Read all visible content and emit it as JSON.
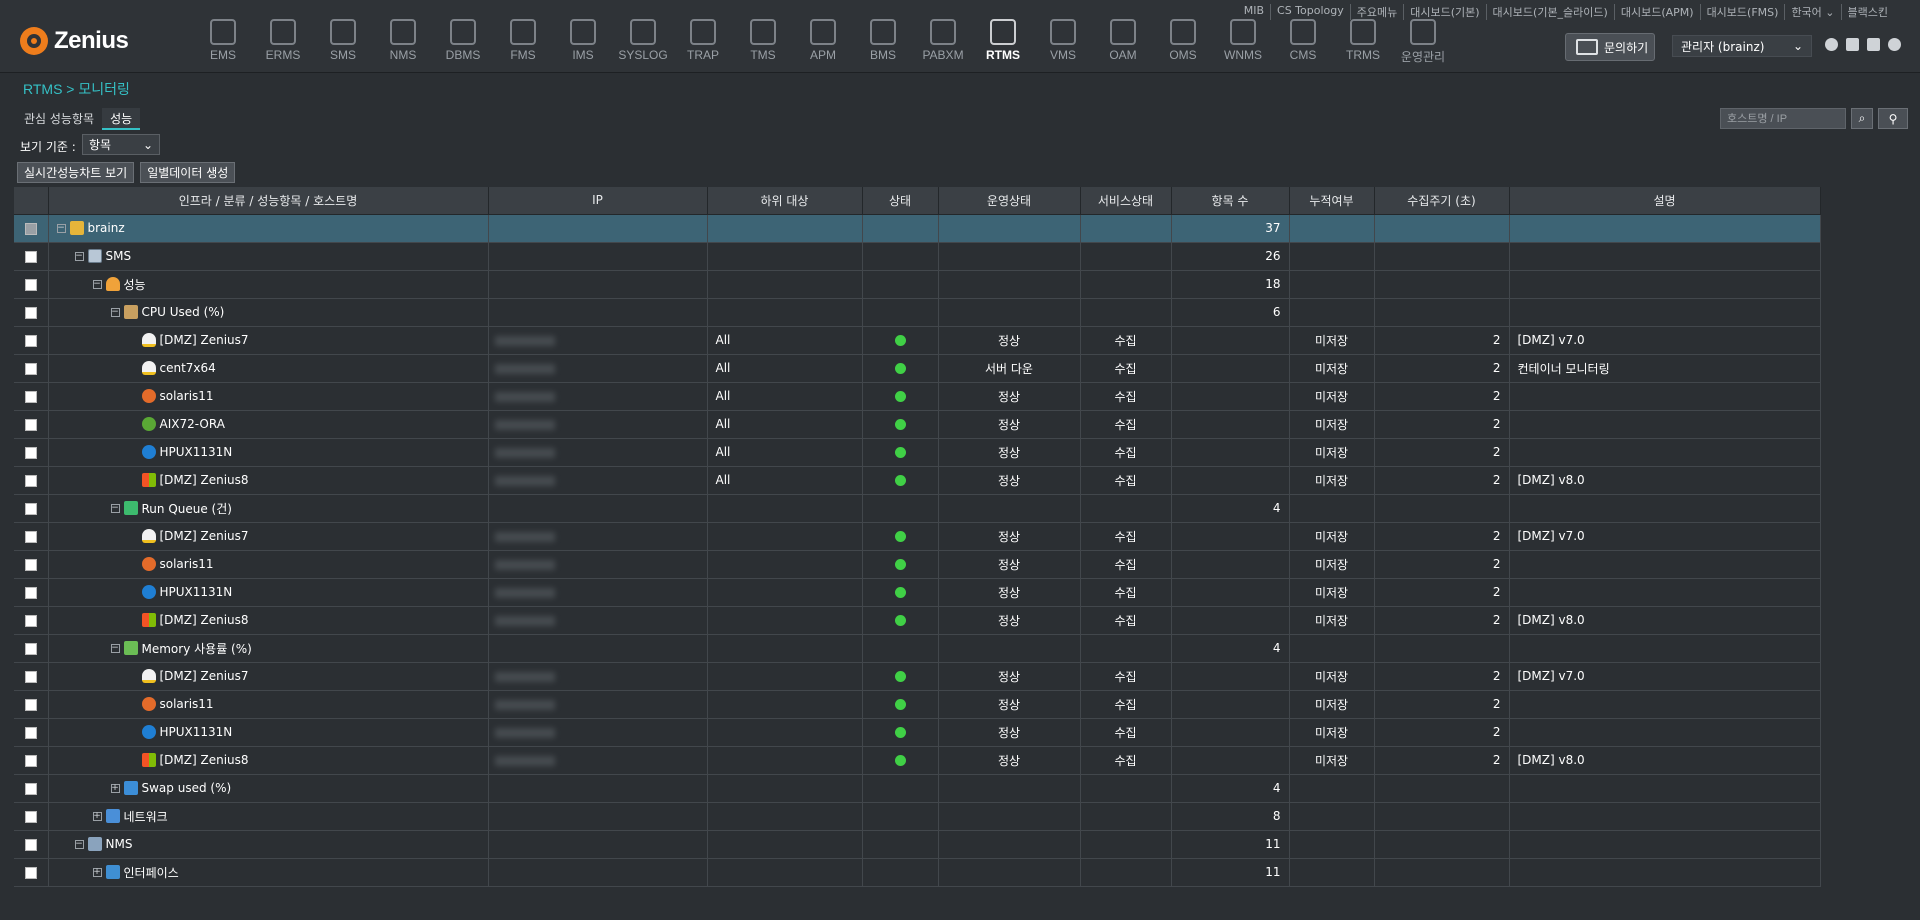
{
  "brand": {
    "name": "Zenius"
  },
  "nav": {
    "items": [
      {
        "label": "EMS",
        "icon": "ems-icon"
      },
      {
        "label": "ERMS",
        "icon": "erms-icon"
      },
      {
        "label": "SMS",
        "icon": "sms-icon"
      },
      {
        "label": "NMS",
        "icon": "nms-icon"
      },
      {
        "label": "DBMS",
        "icon": "dbms-icon"
      },
      {
        "label": "FMS",
        "icon": "fms-icon"
      },
      {
        "label": "IMS",
        "icon": "ims-icon"
      },
      {
        "label": "SYSLOG",
        "icon": "syslog-icon"
      },
      {
        "label": "TRAP",
        "icon": "trap-icon"
      },
      {
        "label": "TMS",
        "icon": "tms-icon"
      },
      {
        "label": "APM",
        "icon": "apm-icon"
      },
      {
        "label": "BMS",
        "icon": "bms-icon"
      },
      {
        "label": "PABXM",
        "icon": "pabxm-icon"
      },
      {
        "label": "RTMS",
        "icon": "rtms-icon",
        "active": true
      },
      {
        "label": "VMS",
        "icon": "vms-icon"
      },
      {
        "label": "OAM",
        "icon": "oam-icon"
      },
      {
        "label": "OMS",
        "icon": "oms-icon"
      },
      {
        "label": "WNMS",
        "icon": "wnms-icon"
      },
      {
        "label": "CMS",
        "icon": "cms-icon"
      },
      {
        "label": "TRMS",
        "icon": "trms-icon"
      },
      {
        "label": "운영관리",
        "icon": "settings-icon"
      }
    ]
  },
  "toplinks": [
    "MIB",
    "CS Topology",
    "주요메뉴",
    "대시보드(기본)",
    "대시보드(기본_슬라이드)",
    "대시보드(APM)",
    "대시보드(FMS)",
    "한국어 ⌄",
    "블랙스킨"
  ],
  "header": {
    "inquiry_label": "문의하기",
    "user_label": "관리자 (brainz)"
  },
  "breadcrumb": "RTMS > 모니터링",
  "tabs": [
    {
      "label": "관심 성능항목",
      "active": false
    },
    {
      "label": "성능",
      "active": true
    }
  ],
  "search": {
    "placeholder": "호스트명 / IP",
    "button_icon": "search-icon",
    "advanced_icon": "advanced-search-icon"
  },
  "view": {
    "label": "보기 기준 :",
    "selected": "항목"
  },
  "buttons": {
    "realtime_chart": "실시간성능차트 보기",
    "daily_data": "일별데이터 생성"
  },
  "table": {
    "columns": [
      "인프라 / 분류 / 성능항목 / 호스트명",
      "IP",
      "하위 대상",
      "상태",
      "운영상태",
      "서비스상태",
      "항목 수",
      "누적여부",
      "수집주기 (초)",
      "설명"
    ],
    "rows": [
      {
        "level": 0,
        "expand": "−",
        "icon": "folder",
        "name": "brainz",
        "count": "37",
        "selected": true
      },
      {
        "level": 1,
        "expand": "−",
        "icon": "server",
        "name": "SMS",
        "count": "26"
      },
      {
        "level": 2,
        "expand": "−",
        "icon": "gauge",
        "name": "성능",
        "count": "18"
      },
      {
        "level": 3,
        "expand": "−",
        "icon": "cpu",
        "name": "CPU Used  (%)",
        "count": "6"
      },
      {
        "level": 4,
        "icon": "linux",
        "name": "[DMZ] Zenius7",
        "ip": true,
        "sub": "All",
        "status": true,
        "op": "정상",
        "svc": "수집",
        "acc": "미저장",
        "cycle": "2",
        "desc": "[DMZ] v7.0"
      },
      {
        "level": 4,
        "icon": "linux",
        "name": "cent7x64",
        "ip": true,
        "sub": "All",
        "status": true,
        "op": "서버 다운",
        "svc": "수집",
        "acc": "미저장",
        "cycle": "2",
        "desc": "컨테이너 모니터링"
      },
      {
        "level": 4,
        "icon": "solaris",
        "name": "solaris11",
        "ip": true,
        "sub": "All",
        "status": true,
        "op": "정상",
        "svc": "수집",
        "acc": "미저장",
        "cycle": "2",
        "desc": ""
      },
      {
        "level": 4,
        "icon": "aix",
        "name": "AIX72-ORA",
        "ip": true,
        "sub": "All",
        "status": true,
        "op": "정상",
        "svc": "수집",
        "acc": "미저장",
        "cycle": "2",
        "desc": ""
      },
      {
        "level": 4,
        "icon": "hp",
        "name": "HPUX1131N",
        "ip": true,
        "sub": "All",
        "status": true,
        "op": "정상",
        "svc": "수집",
        "acc": "미저장",
        "cycle": "2",
        "desc": ""
      },
      {
        "level": 4,
        "icon": "win",
        "name": "[DMZ] Zenius8",
        "ip": true,
        "sub": "All",
        "status": true,
        "op": "정상",
        "svc": "수집",
        "acc": "미저장",
        "cycle": "2",
        "desc": "[DMZ] v8.0"
      },
      {
        "level": 3,
        "expand": "−",
        "icon": "chart",
        "name": "Run Queue (건)",
        "count": "4"
      },
      {
        "level": 4,
        "icon": "linux",
        "name": "[DMZ] Zenius7",
        "ip": true,
        "sub": "",
        "status": true,
        "op": "정상",
        "svc": "수집",
        "acc": "미저장",
        "cycle": "2",
        "desc": "[DMZ] v7.0"
      },
      {
        "level": 4,
        "icon": "solaris",
        "name": "solaris11",
        "ip": true,
        "sub": "",
        "status": true,
        "op": "정상",
        "svc": "수집",
        "acc": "미저장",
        "cycle": "2",
        "desc": ""
      },
      {
        "level": 4,
        "icon": "hp",
        "name": "HPUX1131N",
        "ip": true,
        "sub": "",
        "status": true,
        "op": "정상",
        "svc": "수집",
        "acc": "미저장",
        "cycle": "2",
        "desc": ""
      },
      {
        "level": 4,
        "icon": "win",
        "name": "[DMZ] Zenius8",
        "ip": true,
        "sub": "",
        "status": true,
        "op": "정상",
        "svc": "수집",
        "acc": "미저장",
        "cycle": "2",
        "desc": "[DMZ] v8.0"
      },
      {
        "level": 3,
        "expand": "−",
        "icon": "mem",
        "name": "Memory 사용률 (%)",
        "count": "4"
      },
      {
        "level": 4,
        "icon": "linux",
        "name": "[DMZ] Zenius7",
        "ip": true,
        "sub": "",
        "status": true,
        "op": "정상",
        "svc": "수집",
        "acc": "미저장",
        "cycle": "2",
        "desc": "[DMZ] v7.0"
      },
      {
        "level": 4,
        "icon": "solaris",
        "name": "solaris11",
        "ip": true,
        "sub": "",
        "status": true,
        "op": "정상",
        "svc": "수집",
        "acc": "미저장",
        "cycle": "2",
        "desc": ""
      },
      {
        "level": 4,
        "icon": "hp",
        "name": "HPUX1131N",
        "ip": true,
        "sub": "",
        "status": true,
        "op": "정상",
        "svc": "수집",
        "acc": "미저장",
        "cycle": "2",
        "desc": ""
      },
      {
        "level": 4,
        "icon": "win",
        "name": "[DMZ] Zenius8",
        "ip": true,
        "sub": "",
        "status": true,
        "op": "정상",
        "svc": "수집",
        "acc": "미저장",
        "cycle": "2",
        "desc": "[DMZ] v8.0"
      },
      {
        "level": 3,
        "expand": "+",
        "icon": "swap",
        "name": "Swap used (%)",
        "count": "4"
      },
      {
        "level": 2,
        "expand": "+",
        "icon": "net",
        "name": "네트워크",
        "count": "8"
      },
      {
        "level": 1,
        "expand": "−",
        "icon": "nms",
        "name": "NMS",
        "count": "11"
      },
      {
        "level": 2,
        "expand": "+",
        "icon": "iface",
        "name": "인터페이스",
        "count": "11"
      }
    ]
  },
  "colors": {
    "accent": "#35c1c6",
    "status_ok": "#40d046",
    "selected_row": "#3d6475",
    "background": "#2b2f33"
  }
}
